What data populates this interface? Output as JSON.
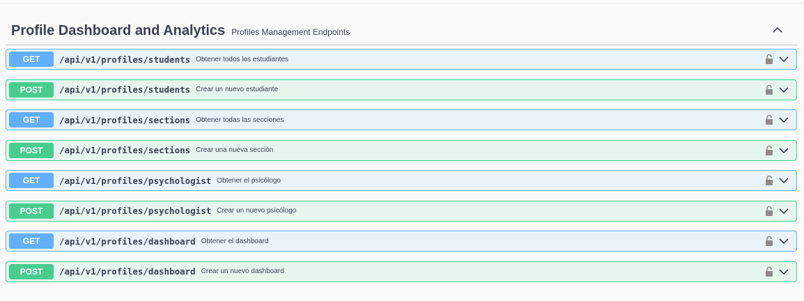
{
  "section": {
    "title": "Profile Dashboard and Analytics",
    "description": "Profiles Management Endpoints"
  },
  "colors": {
    "get": "#61affe",
    "post": "#49cc90",
    "text": "#3b4151"
  },
  "operations": [
    {
      "method": "GET",
      "path": "/api/v1/profiles/students",
      "summary": "Obtener todos los estudiantes"
    },
    {
      "method": "POST",
      "path": "/api/v1/profiles/students",
      "summary": "Crear un nuevo estudiante"
    },
    {
      "method": "GET",
      "path": "/api/v1/profiles/sections",
      "summary": "Obtener todas las secciones"
    },
    {
      "method": "POST",
      "path": "/api/v1/profiles/sections",
      "summary": "Crear una nueva sección"
    },
    {
      "method": "GET",
      "path": "/api/v1/profiles/psychologist",
      "summary": "Obtener el psicólogo"
    },
    {
      "method": "POST",
      "path": "/api/v1/profiles/psychologist",
      "summary": "Crear un nuevo psicólogo"
    },
    {
      "method": "GET",
      "path": "/api/v1/profiles/dashboard",
      "summary": "Obtener el dashboard"
    },
    {
      "method": "POST",
      "path": "/api/v1/profiles/dashboard",
      "summary": "Crear un nuevo dashboard"
    }
  ],
  "icons": {
    "collapse": "chevron-up-icon",
    "lock": "lock-icon",
    "expand": "chevron-down-icon"
  }
}
